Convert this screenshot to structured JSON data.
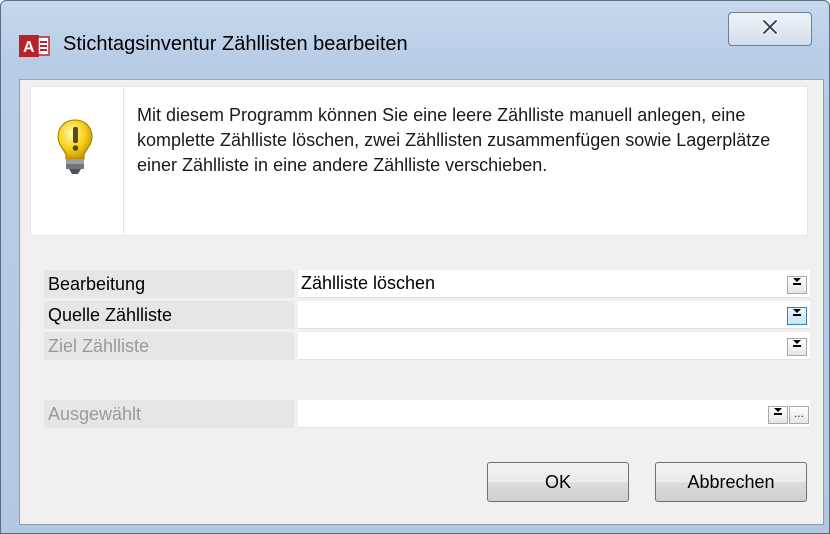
{
  "window": {
    "title": "Stichtagsinventur Zähllisten bearbeiten",
    "app_icon": "access-app-icon",
    "close_icon": "close-icon"
  },
  "info": {
    "icon": "lightbulb-icon",
    "text": "Mit diesem Programm können Sie eine leere Zählliste manuell anlegen, eine komplette Zählliste löschen, zwei Zähllisten zusammenfügen sowie Lagerplätze einer Zählliste in eine andere Zählliste verschieben."
  },
  "fields": {
    "bearbeitung": {
      "label": "Bearbeitung",
      "value": "Zählliste löschen"
    },
    "quelle": {
      "label": "Quelle Zählliste",
      "value": ""
    },
    "ziel": {
      "label": "Ziel Zählliste",
      "value": ""
    },
    "ausgewaehlt": {
      "label": "Ausgewählt",
      "value": "",
      "ellipsis": "..."
    }
  },
  "buttons": {
    "ok": "OK",
    "cancel": "Abbrechen"
  },
  "colors": {
    "titlebar": "#b7cde6",
    "label_bg": "#e6e6e6",
    "disabled_text": "#9a9a9a",
    "bulb": "#f5d21a"
  }
}
